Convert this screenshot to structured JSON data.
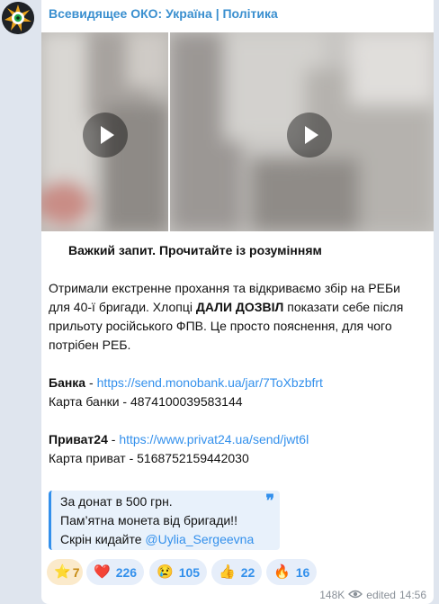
{
  "channel": {
    "name": "Всевидящее ОКО: Україна | Політика"
  },
  "media": [
    {
      "type": "video"
    },
    {
      "type": "video"
    }
  ],
  "post": {
    "title": "Важкий запит. Прочитайте із розумінням",
    "p1_lines": [
      "Отримали екстренне прохання та відкриваємо збір на РЕБи",
      "для 40-ї бригади. Хлопці "
    ],
    "p1_bold": "ДАЛИ ДОЗВІЛ",
    "p1_after_bold": " показати себе після",
    "p1_rest": [
      "прильоту російського ФПВ. Це просто пояснення, для чого",
      "потрібен РЕБ."
    ],
    "bank_label": "Банка",
    "bank_sep": " - ",
    "bank_link": "https://send.monobank.ua/jar/7ToXbzbfrt",
    "bank_card": "Карта банки - 4874100039583144",
    "privat_label": "Приват24",
    "privat_sep": " - ",
    "privat_link": "https://www.privat24.ua/send/jwt6l",
    "privat_card": "Карта приват - 5168752159442030"
  },
  "quote": {
    "line1": "За донат в 500 грн.",
    "line2": "Пам’ятна монета від бригади!!",
    "line3_prefix": "Скрін кидайте ",
    "line3_mention": "@Uylia_Sergeevna"
  },
  "reactions": [
    {
      "emoji": "⭐",
      "count": "7",
      "kind": "paid-star"
    },
    {
      "emoji": "❤️",
      "count": "226",
      "kind": "heart"
    },
    {
      "emoji": "😢",
      "count": "105",
      "kind": "crying"
    },
    {
      "emoji": "👍",
      "count": "22",
      "kind": "thumbs-up"
    },
    {
      "emoji": "🔥",
      "count": "16",
      "kind": "fire"
    }
  ],
  "meta": {
    "views": "148K",
    "edited_label": "edited",
    "time": "14:56"
  },
  "colors": {
    "accent": "#3390ec",
    "channel_name": "#3a8fcf",
    "background": "#dfe5ee"
  }
}
